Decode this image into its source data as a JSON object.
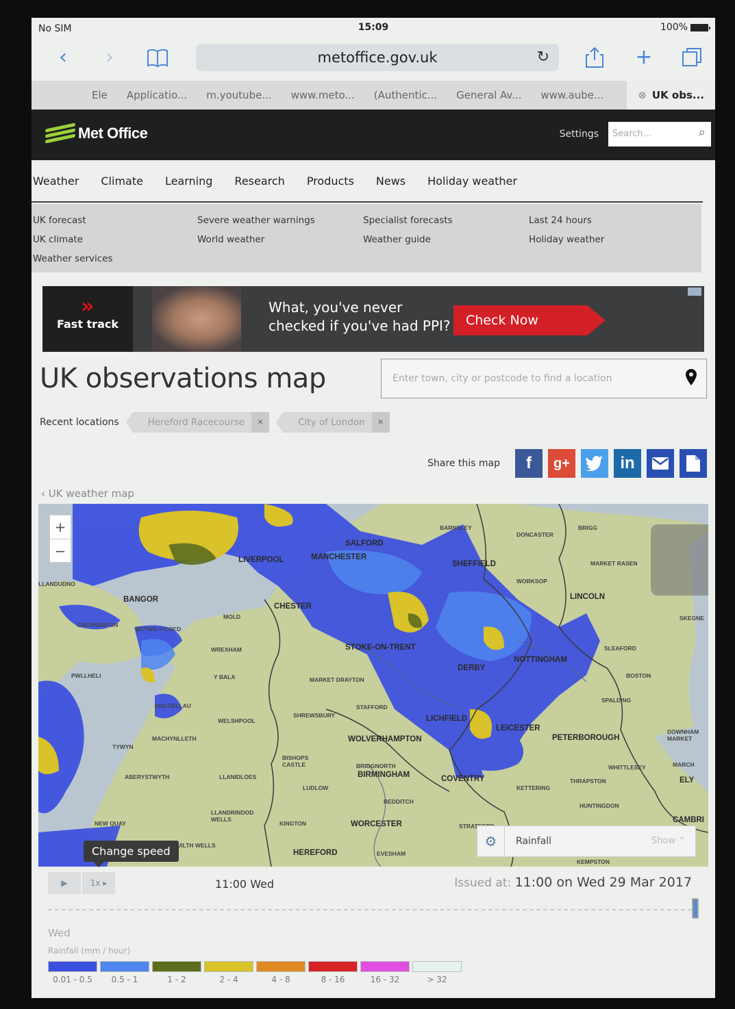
{
  "status": {
    "carrier": "No SIM",
    "time": "15:09",
    "battery": "100%"
  },
  "browser": {
    "url": "metoffice.gov.uk",
    "tabs": [
      "Ele",
      "Applicatio...",
      "m.youtube...",
      "www.meto...",
      "(Authentic...",
      "General Av...",
      "www.aube...",
      "UK obs..."
    ]
  },
  "header": {
    "brand": "Met Office",
    "settings": "Settings",
    "search_placeholder": "Search..."
  },
  "nav": [
    "Weather",
    "Climate",
    "Learning",
    "Research",
    "Products",
    "News",
    "Holiday weather"
  ],
  "subnav": [
    [
      "UK forecast",
      "UK climate",
      "Weather services"
    ],
    [
      "Severe weather warnings",
      "World weather"
    ],
    [
      "Specialist forecasts",
      "Weather guide"
    ],
    [
      "Last 24 hours",
      "Holiday weather"
    ]
  ],
  "ad": {
    "brand": "Fast track",
    "line1": "What, you've never",
    "line2": "checked if you've had PPI?",
    "cta": "Check Now"
  },
  "page": {
    "title": "UK observations map",
    "location_placeholder": "Enter town, city or postcode to find a location",
    "recent_label": "Recent locations",
    "recent": [
      "Hereford Racecourse",
      "City of London"
    ],
    "share_label": "Share this map",
    "back_link": "UK weather map"
  },
  "map": {
    "towns": [
      {
        "name": "LIVERPOOL",
        "size": "big"
      },
      {
        "name": "MANCHESTER",
        "size": "big"
      },
      {
        "name": "SALFORD",
        "size": "big"
      },
      {
        "name": "SHEFFIELD",
        "size": "big"
      },
      {
        "name": "LINCOLN",
        "size": "big"
      },
      {
        "name": "BANGOR",
        "size": "big"
      },
      {
        "name": "CHESTER",
        "size": "big"
      },
      {
        "name": "STOKE-ON-TRENT",
        "size": "big"
      },
      {
        "name": "DERBY",
        "size": "big"
      },
      {
        "name": "NOTTINGHAM",
        "size": "big"
      },
      {
        "name": "LICHFIELD",
        "size": "big"
      },
      {
        "name": "LEICESTER",
        "size": "big"
      },
      {
        "name": "PETERBOROUGH",
        "size": "big"
      },
      {
        "name": "WOLVERHAMPTON",
        "size": "big"
      },
      {
        "name": "BIRMINGHAM",
        "size": "big"
      },
      {
        "name": "COVENTRY",
        "size": "big"
      },
      {
        "name": "WORCESTER",
        "size": "big"
      },
      {
        "name": "HEREFORD",
        "size": "big"
      },
      {
        "name": "ELY",
        "size": "big"
      },
      {
        "name": "CAMBRI",
        "size": "big"
      },
      {
        "name": "BARNSLEY",
        "size": "small"
      },
      {
        "name": "DONCASTER",
        "size": "small"
      },
      {
        "name": "BRIGG",
        "size": "small"
      },
      {
        "name": "MARKET RASEN",
        "size": "small"
      },
      {
        "name": "WORKSOP",
        "size": "small"
      },
      {
        "name": "SKEGNE",
        "size": "small"
      },
      {
        "name": "SLEAFORD",
        "size": "small"
      },
      {
        "name": "BOSTON",
        "size": "small"
      },
      {
        "name": "SPALDING",
        "size": "small"
      },
      {
        "name": "LLANDUDNO",
        "size": "small"
      },
      {
        "name": "MOLD",
        "size": "small"
      },
      {
        "name": "WREXHAM",
        "size": "small"
      },
      {
        "name": "Y BALA",
        "size": "small"
      },
      {
        "name": "WELSHPOOL",
        "size": "small"
      },
      {
        "name": "SHREWSBURY",
        "size": "small"
      },
      {
        "name": "MARKET DRAYTON",
        "size": "small"
      },
      {
        "name": "STAFFORD",
        "size": "small"
      },
      {
        "name": "ABERYSTWYTH",
        "size": "small"
      },
      {
        "name": "TYWYN",
        "size": "small"
      },
      {
        "name": "MACHYNLLETH",
        "size": "small"
      },
      {
        "name": "LLANIDLOES",
        "size": "small"
      },
      {
        "name": "LUDLOW",
        "size": "small"
      },
      {
        "name": "BRIDGNORTH",
        "size": "small"
      },
      {
        "name": "REDDITCH",
        "size": "small"
      },
      {
        "name": "KETTERING",
        "size": "small"
      },
      {
        "name": "THRAPSTON",
        "size": "small"
      },
      {
        "name": "WHITTLESEY",
        "size": "small"
      },
      {
        "name": "HUNTINGDON",
        "size": "small"
      },
      {
        "name": "MARCH",
        "size": "small"
      },
      {
        "name": "DOWNHAM MARKET",
        "size": "small"
      },
      {
        "name": "KINGTON",
        "size": "small"
      },
      {
        "name": "LLANDRINDOD WELLS",
        "size": "small"
      },
      {
        "name": "BUILTH WELLS",
        "size": "small"
      },
      {
        "name": "NEW QUAY",
        "size": "small"
      },
      {
        "name": "EVESHAM",
        "size": "small"
      },
      {
        "name": "STRATFORD",
        "size": "small"
      },
      {
        "name": "KEMPSTON",
        "size": "small"
      },
      {
        "name": "PWLLHELI",
        "size": "small"
      },
      {
        "name": "CAERNARFON",
        "size": "small"
      },
      {
        "name": "BETWS-Y-COED",
        "size": "small"
      },
      {
        "name": "DOLGELLAU",
        "size": "small"
      },
      {
        "name": "BISHOPS CASTLE",
        "size": "small"
      }
    ],
    "layer": "Rainfall",
    "layer_toggle": "Show"
  },
  "timeline": {
    "speed_tooltip": "Change speed",
    "speed_label": "1x",
    "current": "11:00 Wed",
    "issued_label": "Issued at:",
    "issued_value": "11:00 on Wed 29 Mar 2017",
    "day": "Wed",
    "position": 1.0,
    "legend_title": "Rainfall (mm / hour)",
    "legend": [
      {
        "label": "0.01 - 0.5",
        "color": "#3b4fe0"
      },
      {
        "label": "0.5 - 1",
        "color": "#4f86ef"
      },
      {
        "label": "1 - 2",
        "color": "#5c6e1e"
      },
      {
        "label": "2 - 4",
        "color": "#d9c22a"
      },
      {
        "label": "4 - 8",
        "color": "#e08a23"
      },
      {
        "label": "8 - 16",
        "color": "#d62424"
      },
      {
        "label": "16 - 32",
        "color": "#e04fe0"
      },
      {
        "label": "> 32",
        "color": "#e6f4ee"
      }
    ]
  }
}
